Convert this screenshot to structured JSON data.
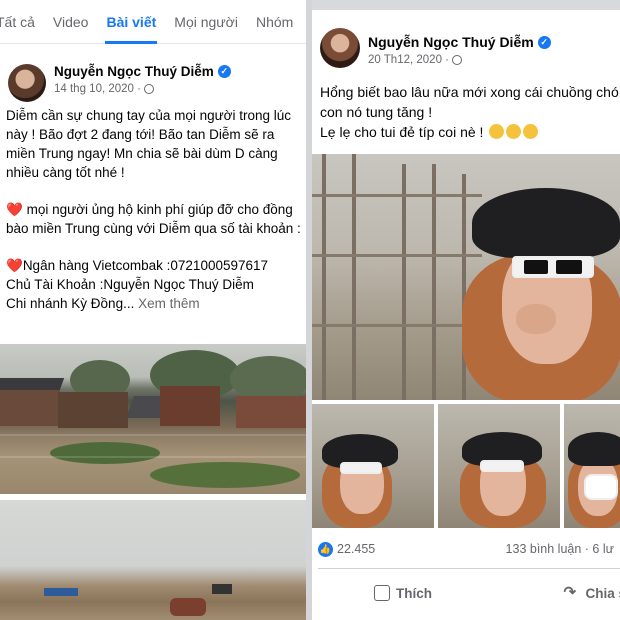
{
  "tabs": [
    "Tất cả",
    "Video",
    "Bài viết",
    "Mọi người",
    "Nhóm"
  ],
  "active_tab_index": 2,
  "colors": {
    "accent": "#1877f2",
    "heart": "#e41e3f",
    "text": "#050505",
    "muted": "#65676b"
  },
  "left_post": {
    "author": "Nguyễn Ngọc Thuý Diễm",
    "verified": true,
    "date": "14 thg 10, 2020 ·",
    "privacy_icon": "globe-icon",
    "paragraphs": [
      "Diễm cần sự chung tay của mọi người trong lúc này ! Bão đợt 2 đang tới! Bão tan Diễm sẽ ra miền Trung ngay! Mn chia sẽ bài dùm D càng nhiều càng tốt nhé !",
      "mọi người ủng hộ kinh phí giúp đỡ cho đồng bào miền Trung cùng với Diễm qua số tài khoản :",
      "Ngân hàng Vietcombak :0721000597617",
      "Chủ Tài Khoản :Nguyễn Ngọc Thuý Diễm",
      "Chi nhánh Kỳ Đồng..."
    ],
    "see_more": "Xem thêm"
  },
  "right_post": {
    "author": "Nguyễn Ngọc Thuý Diễm",
    "verified": true,
    "date": "20 Th12, 2020 ·",
    "privacy_icon": "globe-icon",
    "line1": "Hổng biết bao lâu nữa mới xong cái chuồng chó con nó tung tăng !",
    "line2": "Lẹ lẹ cho tui đẻ típ coi nè !",
    "reactions_count": "22.455",
    "comments": "133 bình luận · 6 lư",
    "like_label": "Thích",
    "share_label": "Chia s"
  }
}
